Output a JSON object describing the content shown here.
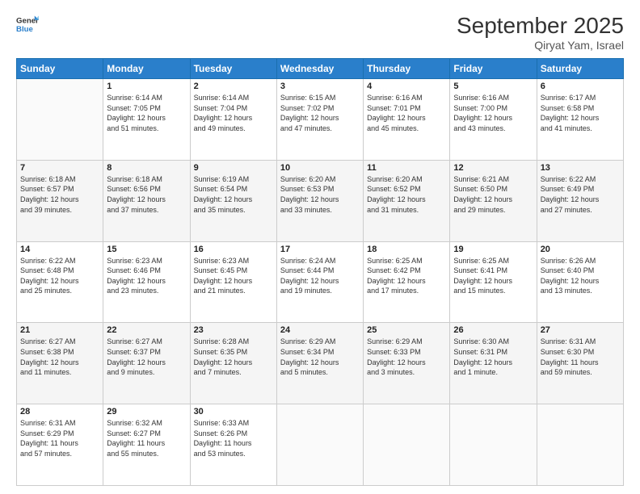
{
  "header": {
    "logo_line1": "General",
    "logo_line2": "Blue",
    "month": "September 2025",
    "location": "Qiryat Yam, Israel"
  },
  "days_of_week": [
    "Sunday",
    "Monday",
    "Tuesday",
    "Wednesday",
    "Thursday",
    "Friday",
    "Saturday"
  ],
  "weeks": [
    [
      {
        "day": "",
        "info": ""
      },
      {
        "day": "1",
        "info": "Sunrise: 6:14 AM\nSunset: 7:05 PM\nDaylight: 12 hours\nand 51 minutes."
      },
      {
        "day": "2",
        "info": "Sunrise: 6:14 AM\nSunset: 7:04 PM\nDaylight: 12 hours\nand 49 minutes."
      },
      {
        "day": "3",
        "info": "Sunrise: 6:15 AM\nSunset: 7:02 PM\nDaylight: 12 hours\nand 47 minutes."
      },
      {
        "day": "4",
        "info": "Sunrise: 6:16 AM\nSunset: 7:01 PM\nDaylight: 12 hours\nand 45 minutes."
      },
      {
        "day": "5",
        "info": "Sunrise: 6:16 AM\nSunset: 7:00 PM\nDaylight: 12 hours\nand 43 minutes."
      },
      {
        "day": "6",
        "info": "Sunrise: 6:17 AM\nSunset: 6:58 PM\nDaylight: 12 hours\nand 41 minutes."
      }
    ],
    [
      {
        "day": "7",
        "info": "Sunrise: 6:18 AM\nSunset: 6:57 PM\nDaylight: 12 hours\nand 39 minutes."
      },
      {
        "day": "8",
        "info": "Sunrise: 6:18 AM\nSunset: 6:56 PM\nDaylight: 12 hours\nand 37 minutes."
      },
      {
        "day": "9",
        "info": "Sunrise: 6:19 AM\nSunset: 6:54 PM\nDaylight: 12 hours\nand 35 minutes."
      },
      {
        "day": "10",
        "info": "Sunrise: 6:20 AM\nSunset: 6:53 PM\nDaylight: 12 hours\nand 33 minutes."
      },
      {
        "day": "11",
        "info": "Sunrise: 6:20 AM\nSunset: 6:52 PM\nDaylight: 12 hours\nand 31 minutes."
      },
      {
        "day": "12",
        "info": "Sunrise: 6:21 AM\nSunset: 6:50 PM\nDaylight: 12 hours\nand 29 minutes."
      },
      {
        "day": "13",
        "info": "Sunrise: 6:22 AM\nSunset: 6:49 PM\nDaylight: 12 hours\nand 27 minutes."
      }
    ],
    [
      {
        "day": "14",
        "info": "Sunrise: 6:22 AM\nSunset: 6:48 PM\nDaylight: 12 hours\nand 25 minutes."
      },
      {
        "day": "15",
        "info": "Sunrise: 6:23 AM\nSunset: 6:46 PM\nDaylight: 12 hours\nand 23 minutes."
      },
      {
        "day": "16",
        "info": "Sunrise: 6:23 AM\nSunset: 6:45 PM\nDaylight: 12 hours\nand 21 minutes."
      },
      {
        "day": "17",
        "info": "Sunrise: 6:24 AM\nSunset: 6:44 PM\nDaylight: 12 hours\nand 19 minutes."
      },
      {
        "day": "18",
        "info": "Sunrise: 6:25 AM\nSunset: 6:42 PM\nDaylight: 12 hours\nand 17 minutes."
      },
      {
        "day": "19",
        "info": "Sunrise: 6:25 AM\nSunset: 6:41 PM\nDaylight: 12 hours\nand 15 minutes."
      },
      {
        "day": "20",
        "info": "Sunrise: 6:26 AM\nSunset: 6:40 PM\nDaylight: 12 hours\nand 13 minutes."
      }
    ],
    [
      {
        "day": "21",
        "info": "Sunrise: 6:27 AM\nSunset: 6:38 PM\nDaylight: 12 hours\nand 11 minutes."
      },
      {
        "day": "22",
        "info": "Sunrise: 6:27 AM\nSunset: 6:37 PM\nDaylight: 12 hours\nand 9 minutes."
      },
      {
        "day": "23",
        "info": "Sunrise: 6:28 AM\nSunset: 6:35 PM\nDaylight: 12 hours\nand 7 minutes."
      },
      {
        "day": "24",
        "info": "Sunrise: 6:29 AM\nSunset: 6:34 PM\nDaylight: 12 hours\nand 5 minutes."
      },
      {
        "day": "25",
        "info": "Sunrise: 6:29 AM\nSunset: 6:33 PM\nDaylight: 12 hours\nand 3 minutes."
      },
      {
        "day": "26",
        "info": "Sunrise: 6:30 AM\nSunset: 6:31 PM\nDaylight: 12 hours\nand 1 minute."
      },
      {
        "day": "27",
        "info": "Sunrise: 6:31 AM\nSunset: 6:30 PM\nDaylight: 11 hours\nand 59 minutes."
      }
    ],
    [
      {
        "day": "28",
        "info": "Sunrise: 6:31 AM\nSunset: 6:29 PM\nDaylight: 11 hours\nand 57 minutes."
      },
      {
        "day": "29",
        "info": "Sunrise: 6:32 AM\nSunset: 6:27 PM\nDaylight: 11 hours\nand 55 minutes."
      },
      {
        "day": "30",
        "info": "Sunrise: 6:33 AM\nSunset: 6:26 PM\nDaylight: 11 hours\nand 53 minutes."
      },
      {
        "day": "",
        "info": ""
      },
      {
        "day": "",
        "info": ""
      },
      {
        "day": "",
        "info": ""
      },
      {
        "day": "",
        "info": ""
      }
    ]
  ]
}
